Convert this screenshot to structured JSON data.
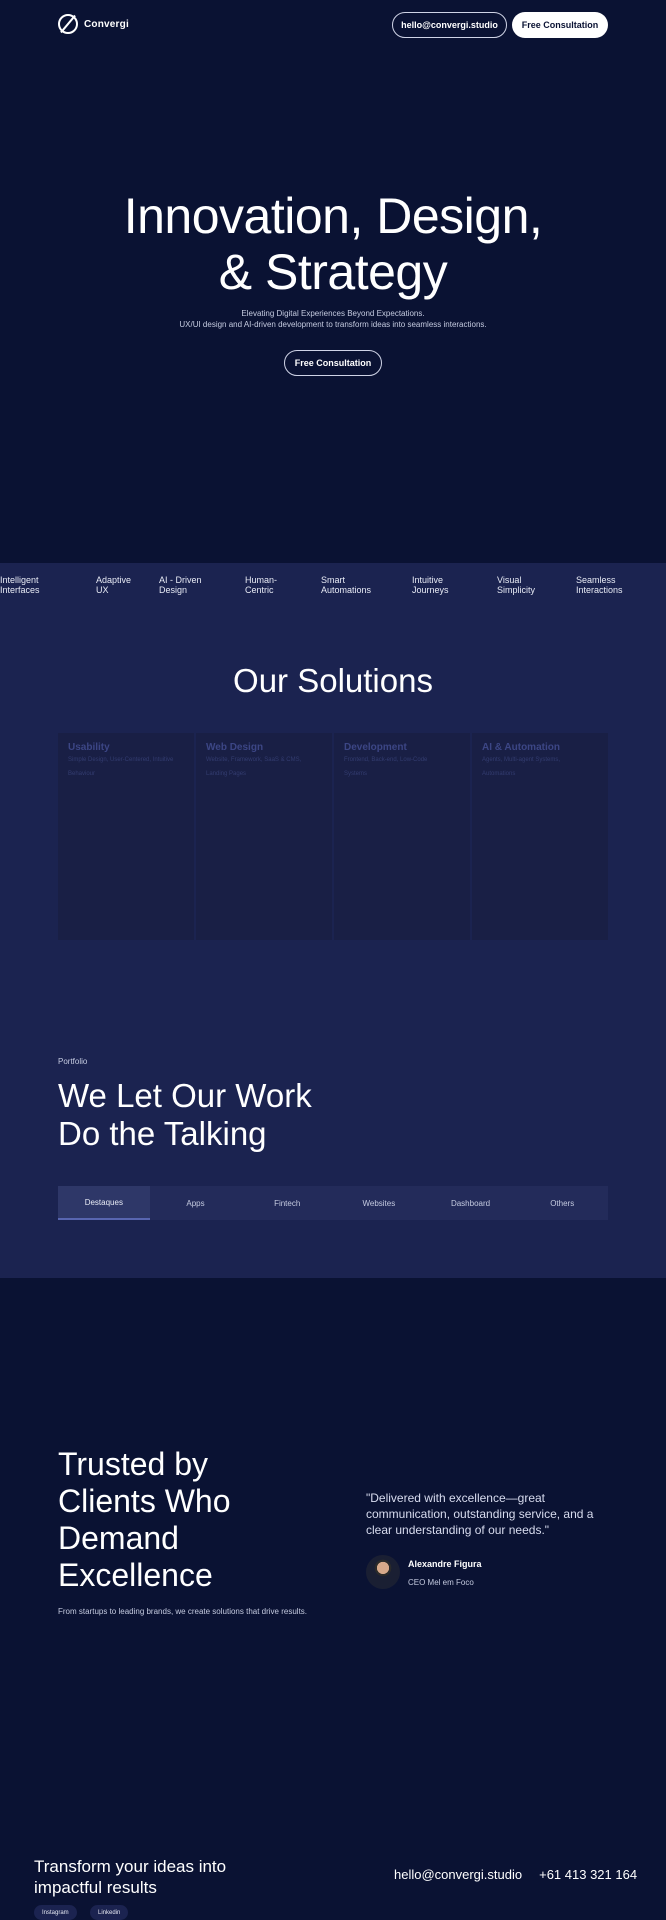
{
  "header": {
    "brand": "Convergi",
    "email_button": "hello@convergi.studio",
    "consult_button": "Free Consultation"
  },
  "hero": {
    "title_line1": "Innovation, Design,",
    "title_line2": "& Strategy",
    "sub_line1": "Elevating Digital Experiences Beyond Expectations.",
    "sub_line2": "UX/UI design and AI-driven development to transform ideas into seamless interactions.",
    "cta": "Free Consultation"
  },
  "marquee": [
    [
      "Intelligent",
      "Interfaces"
    ],
    [
      "Adaptive",
      "UX"
    ],
    [
      "AI - Driven",
      "Design"
    ],
    [
      "Human-",
      "Centric"
    ],
    [
      "Smart",
      "Automations"
    ],
    [
      "Intuitive",
      "Journeys"
    ],
    [
      "Visual",
      "Simplicity"
    ],
    [
      "Seamless",
      "Interactions"
    ]
  ],
  "solutions": {
    "title": "Our Solutions",
    "cards": [
      {
        "name": "Usability",
        "desc1": "Simple Design, User-Centered, Intuitive",
        "desc2": "Behaviour"
      },
      {
        "name": "Web Design",
        "desc1": "Website, Framework, SaaS & CMS,",
        "desc2": "Landing Pages"
      },
      {
        "name": "Development",
        "desc1": "Frontend, Back-end, Low-Code",
        "desc2": "Systems"
      },
      {
        "name": "AI & Automation",
        "desc1": "Agents, Multi-agent Systems,",
        "desc2": "Automations"
      }
    ]
  },
  "portfolio": {
    "label": "Portfolio",
    "title_line1": "We Let Our Work",
    "title_line2": "Do the Talking",
    "tabs": [
      "Destaques",
      "Apps",
      "Fintech",
      "Websites",
      "Dashboard",
      "Others"
    ],
    "active_tab": "Destaques"
  },
  "trusted": {
    "title_lines": [
      "Trusted by",
      "Clients Who",
      "Demand",
      "Excellence"
    ],
    "subtitle": "From startups to leading brands, we create solutions that drive results.",
    "quote": "\"Delivered with excellence—great communication, outstanding service, and a clear understanding of our needs.\"",
    "author_name": "Alexandre Figura",
    "author_role": "CEO Mel em Foco"
  },
  "footer": {
    "title_line1": "Transform your ideas into",
    "title_line2": "impactful results",
    "email": "hello@convergi.studio",
    "phone": "+61 413 321 164",
    "socials": [
      "Instagram",
      "Linkedin"
    ]
  },
  "colors": {
    "background": "#0a1233",
    "navy_section": "#1b2350",
    "card": "#191f45"
  }
}
